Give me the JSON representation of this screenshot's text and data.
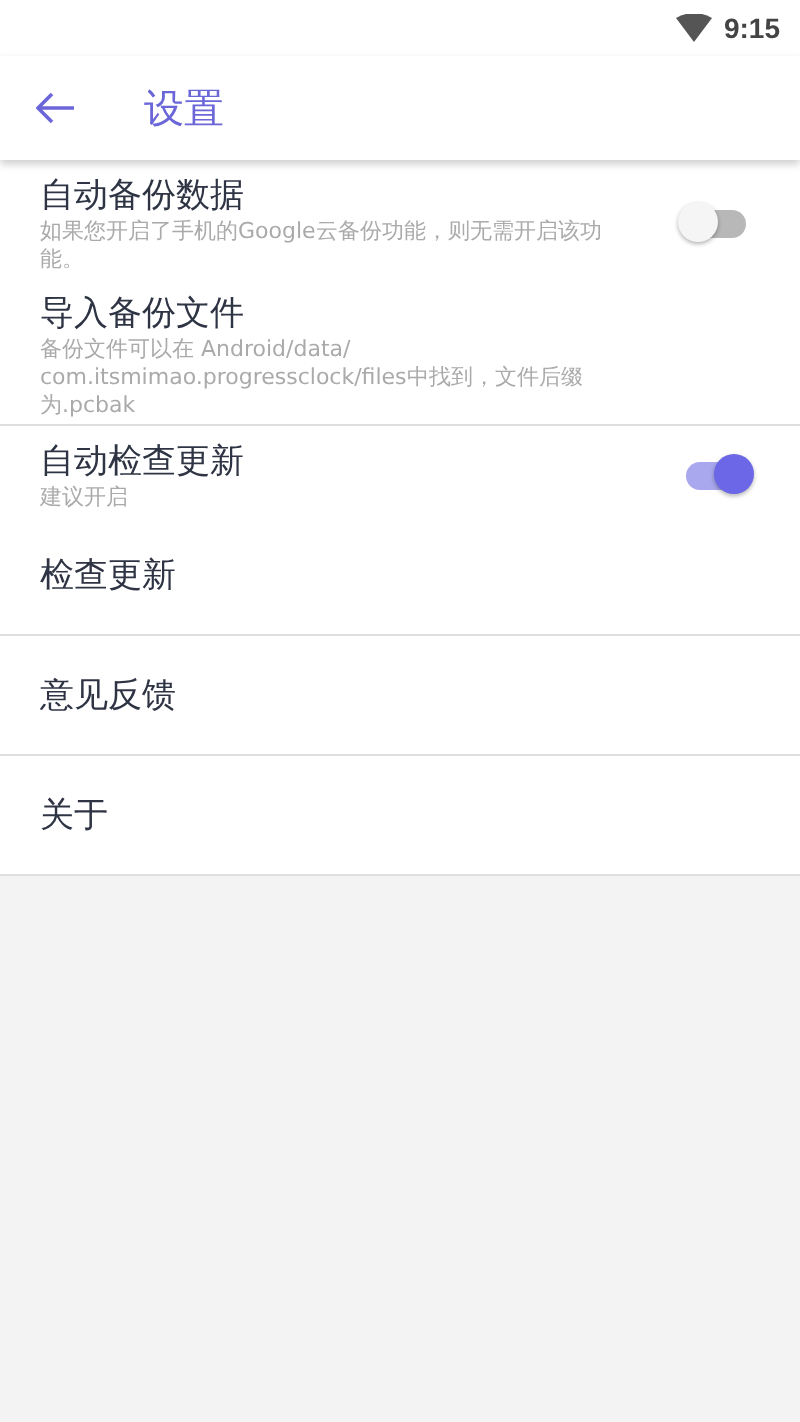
{
  "status_bar": {
    "time": "9:15"
  },
  "app_bar": {
    "title": "设置"
  },
  "groups": [
    {
      "items": [
        {
          "kind": "switch",
          "title": "自动备份数据",
          "subtitle": "如果您开启了手机的Google云备份功能，则无需开启该功能。",
          "on": false
        },
        {
          "kind": "plain",
          "title": "导入备份文件",
          "subtitle": "备份文件可以在 Android/data/ com.itsmimao.progressclock/files中找到，文件后缀为.pcbak"
        }
      ]
    },
    {
      "items": [
        {
          "kind": "switch",
          "title": "自动检查更新",
          "subtitle": "建议开启",
          "on": true
        },
        {
          "kind": "plain",
          "title": "检查更新"
        }
      ]
    },
    {
      "items": [
        {
          "kind": "plain",
          "title": "意见反馈"
        }
      ]
    },
    {
      "items": [
        {
          "kind": "plain",
          "title": "关于"
        }
      ]
    }
  ]
}
